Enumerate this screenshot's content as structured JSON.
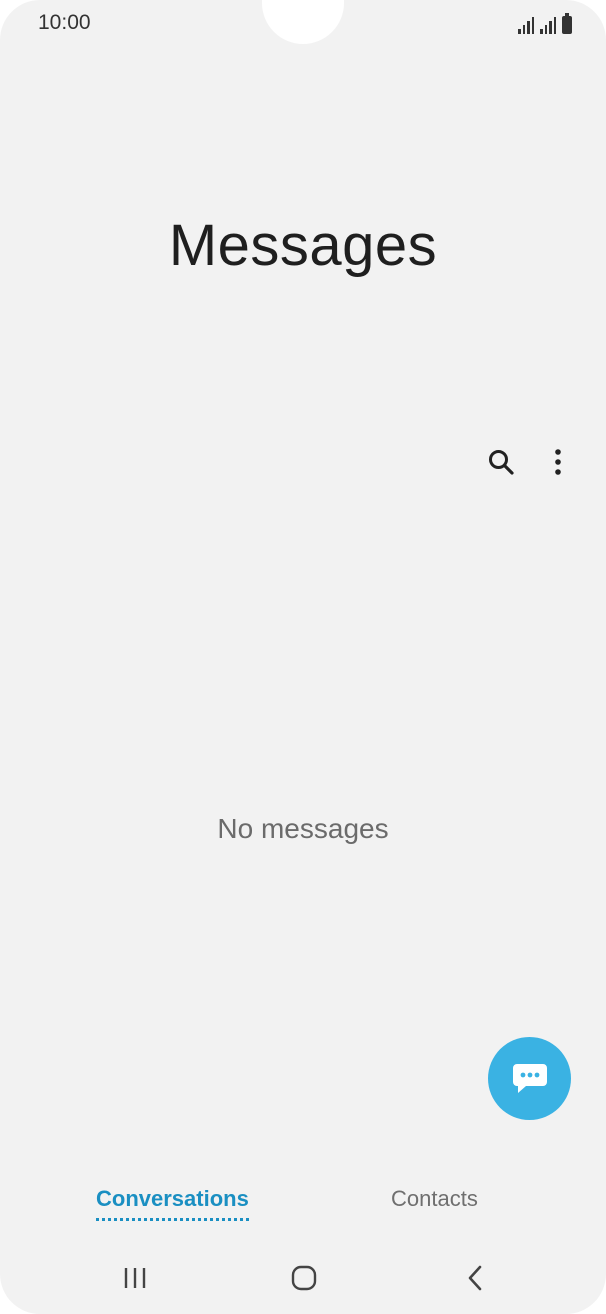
{
  "status_bar": {
    "time": "10:00"
  },
  "header": {
    "title": "Messages"
  },
  "toolbar": {
    "search_icon": "search-icon",
    "more_icon": "more-vertical-icon"
  },
  "main": {
    "empty_text": "No messages"
  },
  "fab": {
    "icon": "chat-bubble-icon",
    "color": "#3ab2e3"
  },
  "tabs": [
    {
      "label": "Conversations",
      "active": true,
      "color": "#1a8fc2"
    },
    {
      "label": "Contacts",
      "active": false,
      "color": "#6f6f6f"
    }
  ],
  "nav_bar": {
    "recents_icon": "recents-icon",
    "home_icon": "home-icon",
    "back_icon": "back-icon"
  }
}
